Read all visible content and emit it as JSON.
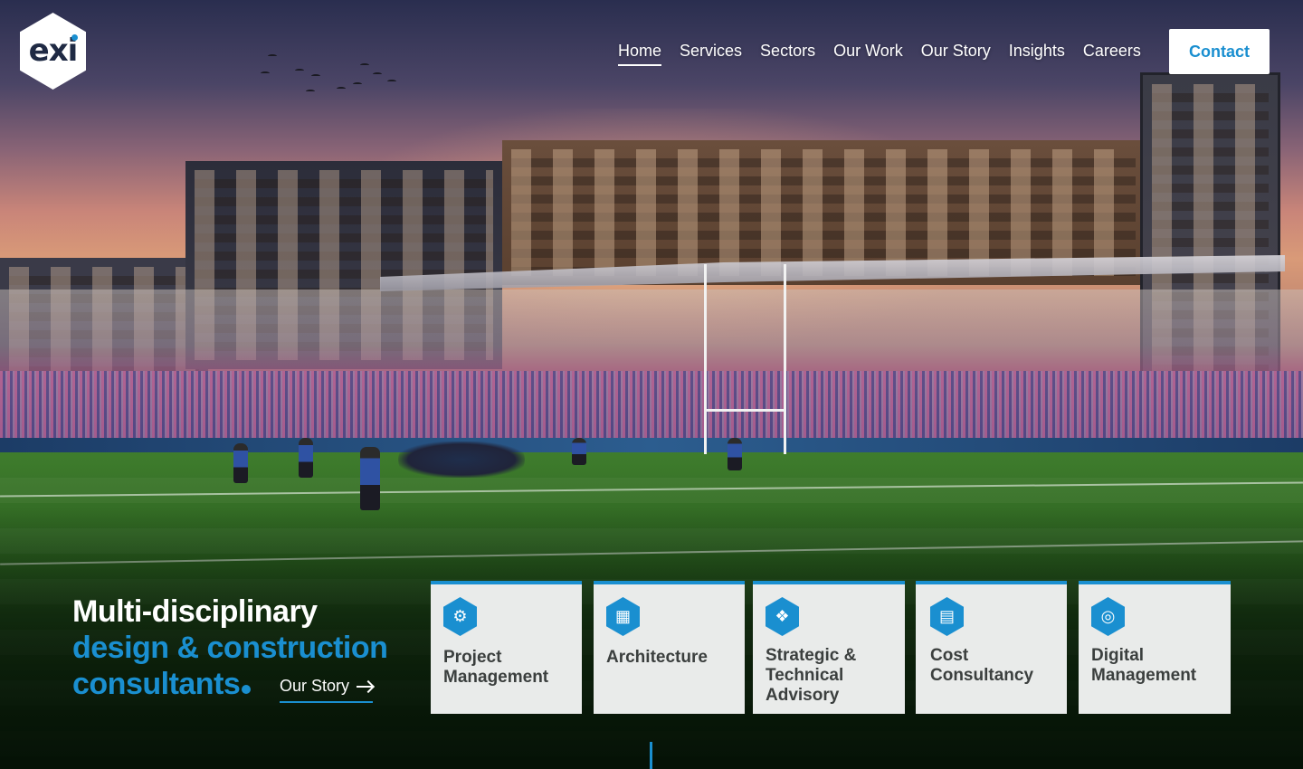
{
  "brand": {
    "logo_text": "exi",
    "accent_color": "#1a8fd0"
  },
  "nav": {
    "items": [
      {
        "label": "Home",
        "active": true
      },
      {
        "label": "Services",
        "active": false
      },
      {
        "label": "Sectors",
        "active": false
      },
      {
        "label": "Our Work",
        "active": false
      },
      {
        "label": "Our Story",
        "active": false
      },
      {
        "label": "Insights",
        "active": false
      },
      {
        "label": "Careers",
        "active": false
      }
    ],
    "contact_label": "Contact"
  },
  "hero": {
    "line1": "Multi-disciplinary",
    "line2": "design & construction",
    "line3": "consultants",
    "story_link": "Our Story"
  },
  "cards": [
    {
      "icon": "gear-clock-icon",
      "lines": [
        "Project",
        "Management"
      ]
    },
    {
      "icon": "cubes-icon",
      "lines": [
        "Architecture"
      ]
    },
    {
      "icon": "puzzle-icon",
      "lines": [
        "Strategic &",
        "Technical",
        "Advisory"
      ]
    },
    {
      "icon": "chart-icon",
      "lines": [
        "Cost",
        "Consultancy"
      ]
    },
    {
      "icon": "globe-icon",
      "lines": [
        "Digital",
        "Management"
      ]
    }
  ]
}
